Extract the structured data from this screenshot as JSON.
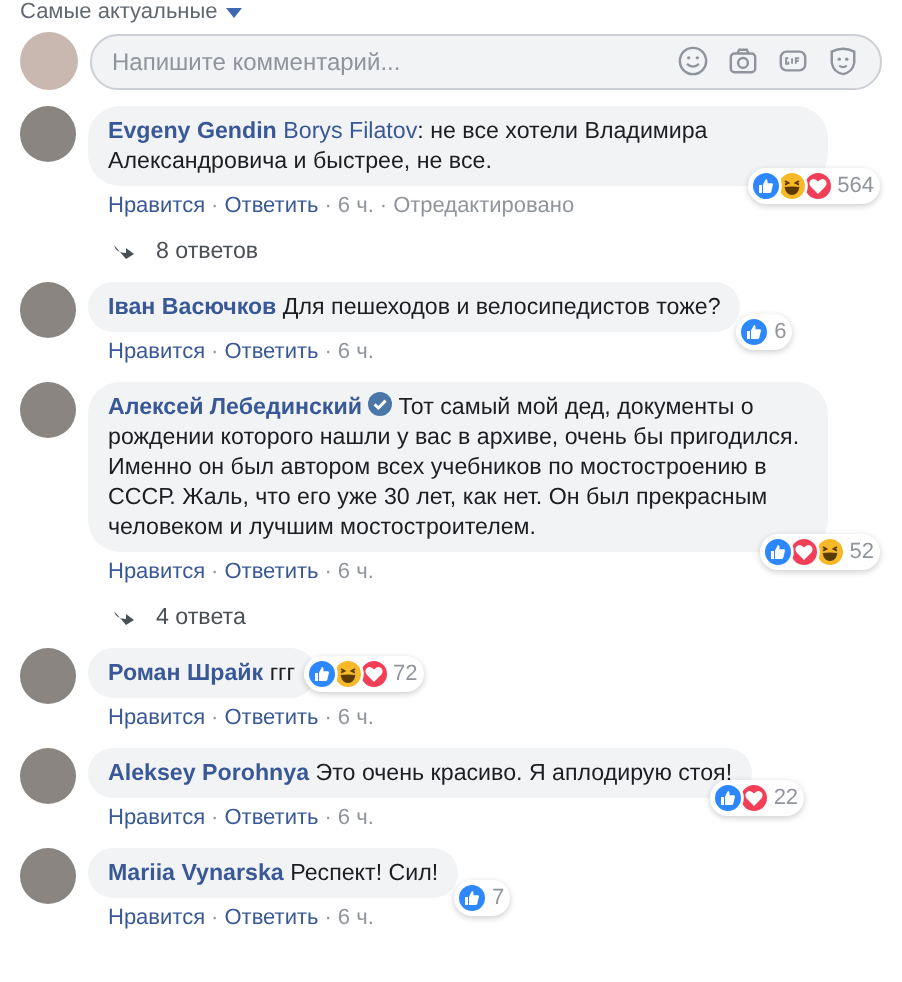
{
  "sort_label": "Самые актуальные",
  "composer": {
    "placeholder": "Напишите комментарий..."
  },
  "separator": "·",
  "comments": [
    {
      "author": "Evgeny Gendin",
      "verified": false,
      "mention": "Borys Filatov",
      "text": ": не все хотели Владимира Александровича и быстрее, не все.",
      "reactions": [
        {
          "kind": "like"
        },
        {
          "kind": "haha"
        },
        {
          "kind": "love"
        }
      ],
      "reaction_count": "564",
      "reactions_beside": false,
      "actions": [
        {
          "label": "Нравится",
          "kind": "link"
        },
        {
          "label": "Ответить",
          "kind": "link"
        },
        {
          "label": "6 ч.",
          "kind": "time"
        },
        {
          "label": "Отредактировано",
          "kind": "note"
        }
      ],
      "replies": "8 ответов"
    },
    {
      "author": "Іван Васючков",
      "verified": false,
      "text": "Для пешеходов и велосипедистов тоже?",
      "reactions": [
        {
          "kind": "like"
        }
      ],
      "reaction_count": "6",
      "reactions_beside": false,
      "actions": [
        {
          "label": "Нравится",
          "kind": "link"
        },
        {
          "label": "Ответить",
          "kind": "link"
        },
        {
          "label": "6 ч.",
          "kind": "time"
        }
      ]
    },
    {
      "author": "Алексей Лебединский",
      "verified": true,
      "text": "Тот самый мой дед, документы о рождении которого нашли у вас в архиве, очень бы пригодился. Именно он был автором всех учебников по мостостроению в СССР. Жаль, что его уже 30 лет, как нет. Он был прекрасным человеком и лучшим мостостроителем.",
      "reactions": [
        {
          "kind": "like"
        },
        {
          "kind": "love"
        },
        {
          "kind": "haha"
        }
      ],
      "reaction_count": "52",
      "reactions_beside": false,
      "actions": [
        {
          "label": "Нравится",
          "kind": "link"
        },
        {
          "label": "Ответить",
          "kind": "link"
        },
        {
          "label": "6 ч.",
          "kind": "time"
        }
      ],
      "replies": "4 ответа"
    },
    {
      "author": "Роман Шрайк",
      "verified": false,
      "text": "ггг",
      "reactions": [
        {
          "kind": "like"
        },
        {
          "kind": "haha"
        },
        {
          "kind": "love"
        }
      ],
      "reaction_count": "72",
      "reactions_beside": true,
      "actions": [
        {
          "label": "Нравится",
          "kind": "link"
        },
        {
          "label": "Ответить",
          "kind": "link"
        },
        {
          "label": "6 ч.",
          "kind": "time"
        }
      ]
    },
    {
      "author": "Aleksey Porohnya",
      "verified": false,
      "text": "Это очень красиво. Я аплодирую стоя!",
      "reactions": [
        {
          "kind": "like"
        },
        {
          "kind": "love"
        }
      ],
      "reaction_count": "22",
      "reactions_beside": false,
      "actions": [
        {
          "label": "Нравится",
          "kind": "link"
        },
        {
          "label": "Ответить",
          "kind": "link"
        },
        {
          "label": "6 ч.",
          "kind": "time"
        }
      ]
    },
    {
      "author": "Mariia Vynarska",
      "verified": false,
      "text": "Респект! Сил!",
      "reactions": [
        {
          "kind": "like"
        }
      ],
      "reaction_count": "7",
      "reactions_beside": false,
      "actions": [
        {
          "label": "Нравится",
          "kind": "link"
        },
        {
          "label": "Ответить",
          "kind": "link"
        },
        {
          "label": "6 ч.",
          "kind": "time"
        }
      ]
    }
  ]
}
